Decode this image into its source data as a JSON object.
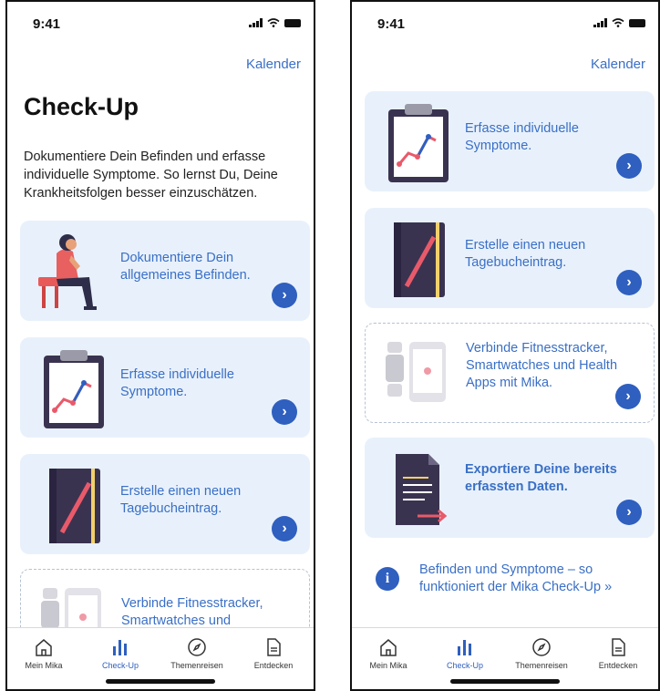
{
  "status": {
    "time": "9:41"
  },
  "left": {
    "top_link": "Kalender",
    "title": "Check-Up",
    "intro": "Dokumentiere Dein Befinden und erfasse individuelle Symptome. So lernst Du, Deine Krankheitsfolgen besser einzuschätzen.",
    "cards": [
      {
        "label": "Dokumentiere Dein allgemeines Befinden.",
        "illustration": "person-sitting-illustration"
      },
      {
        "label": "Erfasse individuelle Symptome.",
        "illustration": "clipboard-chart-illustration"
      },
      {
        "label": "Erstelle einen neuen Tagebucheintrag.",
        "illustration": "diary-book-illustration"
      },
      {
        "label": "Verbinde Fitnesstracker, Smartwatches und",
        "illustration": "devices-illustration"
      }
    ]
  },
  "right": {
    "top_link": "Kalender",
    "cards": [
      {
        "label": "Erfasse individuelle Symptome.",
        "illustration": "clipboard-chart-illustration"
      },
      {
        "label": "Erstelle einen neuen Tagebucheintrag.",
        "illustration": "diary-book-illustration"
      },
      {
        "label": "Verbinde Fitnesstracker, Smartwatches und Health Apps mit Mika.",
        "illustration": "devices-illustration"
      },
      {
        "label": "Exportiere Deine bereits erfassten Daten.",
        "illustration": "document-export-illustration"
      }
    ],
    "info": "Befinden und Symptome – so funktioniert der Mika Check-Up »"
  },
  "tabbar": {
    "items": [
      {
        "label": "Mein Mika",
        "icon": "home-icon"
      },
      {
        "label": "Check-Up",
        "icon": "bar-chart-icon",
        "active": true
      },
      {
        "label": "Themenreisen",
        "icon": "compass-icon"
      },
      {
        "label": "Entdecken",
        "icon": "document-icon"
      }
    ]
  },
  "colors": {
    "accent": "#2f5fbf",
    "link": "#3a6fc6",
    "card_bg": "#e8f1fb"
  }
}
